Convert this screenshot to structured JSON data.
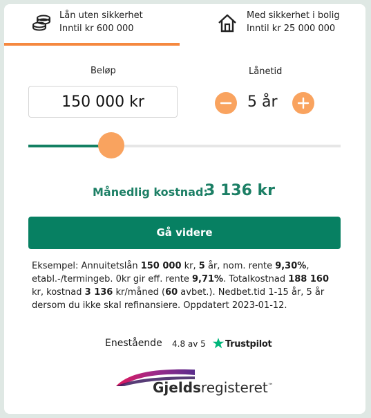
{
  "tabs": [
    {
      "title": "Lån uten sikkerhet",
      "subtitle": "Inntil kr 600 000",
      "icon": "coins-icon",
      "active": true
    },
    {
      "title": "Med sikkerhet i bolig",
      "subtitle": "Inntil kr 25 000 000",
      "icon": "house-icon",
      "active": false
    }
  ],
  "calculator": {
    "amount_label": "Beløp",
    "amount_value": "150 000 kr",
    "term_label": "Lånetid",
    "term_value": "5 år",
    "minus": "−",
    "plus": "+",
    "slider_fraction": 0.265
  },
  "cost": {
    "label": "Månedlig kostnad:",
    "value": "3 136 kr"
  },
  "cta": "Gå videre",
  "example": {
    "p1": "Eksempel: Annuitetslån ",
    "b1": "150 000",
    "p2": " kr, ",
    "b2": "5",
    "p3": " år, nom. rente ",
    "b3": "9,30%",
    "p4": ", etabl.-/termingeb. 0kr gir eff. rente ",
    "b4": "9,71%",
    "p5": ". Totalkostnad ",
    "b5": "188 160",
    "p6": " kr, kostnad ",
    "b6": "3 136",
    "p7": " kr/måned (",
    "b7": "60",
    "p8": " avbet.). Nedbet.tid 1-15 år, 5 år dersom du ikke skal refinansiere. Oppdatert 2023-01-12."
  },
  "trustpilot": {
    "rating_word": "Enestående",
    "score": "4.8 av 5",
    "brand": "Trustpilot",
    "star_color": "#00b67a"
  },
  "logo": {
    "text_bold": "Gjelds",
    "text_regular": "registeret",
    "tm": "™"
  },
  "colors": {
    "accent_orange": "#f5883f",
    "green": "#078062",
    "text_green": "#1c7f65"
  }
}
